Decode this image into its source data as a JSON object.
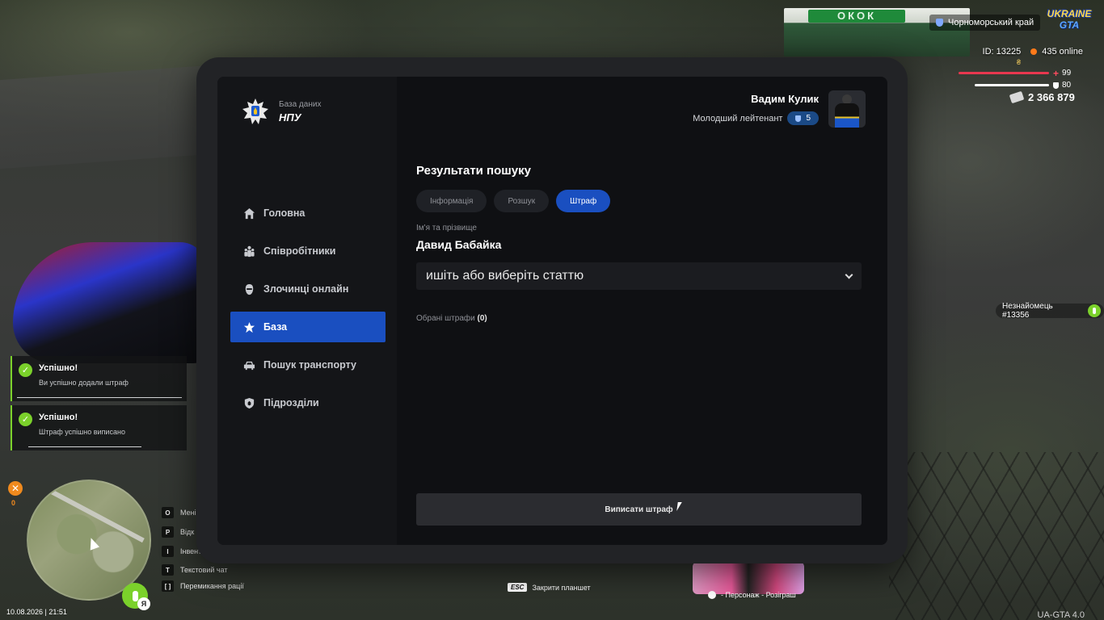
{
  "hud": {
    "region": "Чорноморський край",
    "logo_top": "UKRAINE",
    "logo_bottom": "GTA",
    "player_id": "ID: 13225",
    "online": "435 online",
    "health": "99",
    "armor": "80",
    "health_level": 0.99,
    "armor_level": 0.8,
    "money": "2 366 879",
    "nearby_player": "Незнайомець #13356"
  },
  "notifications": [
    {
      "title": "Успішно!",
      "text": "Ви успішно додали штраф"
    },
    {
      "title": "Успішно!",
      "text": "Штраф успішно виписано"
    }
  ],
  "radar": {
    "count": "0",
    "lang": "Я"
  },
  "keybinds": [
    {
      "key": "O",
      "label": "Мені"
    },
    {
      "key": "P",
      "label": "Відк"
    },
    {
      "key": "I",
      "label": "Інвент"
    },
    {
      "key": "T",
      "label": "Текстовий чат"
    },
    {
      "key": "[   ]",
      "label": "Перемикання рації"
    }
  ],
  "datetime": "10.08.2026 | 21:51",
  "version": "UA-GTA 4.0",
  "esc_hint": {
    "key": "ESC",
    "label": "Закрити планшет"
  },
  "promo_label": "- Персонаж - Розіграш",
  "tablet": {
    "brand": {
      "subtitle": "База даних",
      "title": "НПУ"
    },
    "menu": [
      {
        "label": "Головна",
        "icon": "home-icon"
      },
      {
        "label": "Співробітники",
        "icon": "staff-icon"
      },
      {
        "label": "Злочинці онлайн",
        "icon": "criminal-icon"
      },
      {
        "label": "База",
        "icon": "star-icon",
        "active": true
      },
      {
        "label": "Пошук транспорту",
        "icon": "car-icon"
      },
      {
        "label": "Підрозділи",
        "icon": "shield-icon"
      }
    ],
    "user": {
      "name": "Вадим Кулик",
      "rank": "Молодший лейтенант",
      "level": "5"
    },
    "results_title": "Результати пошуку",
    "tabs": [
      {
        "label": "Інформація"
      },
      {
        "label": "Розшук"
      },
      {
        "label": "Штраф",
        "active": true
      }
    ],
    "name_label": "Ім'я та прізвище",
    "name_value": "Давид Бабайка",
    "article_select": "ишіть або виберіть статтю",
    "selected_fines_label": "Обрані штрафи",
    "selected_fines_count": "(0)",
    "issue_button": "Виписати штраф"
  }
}
